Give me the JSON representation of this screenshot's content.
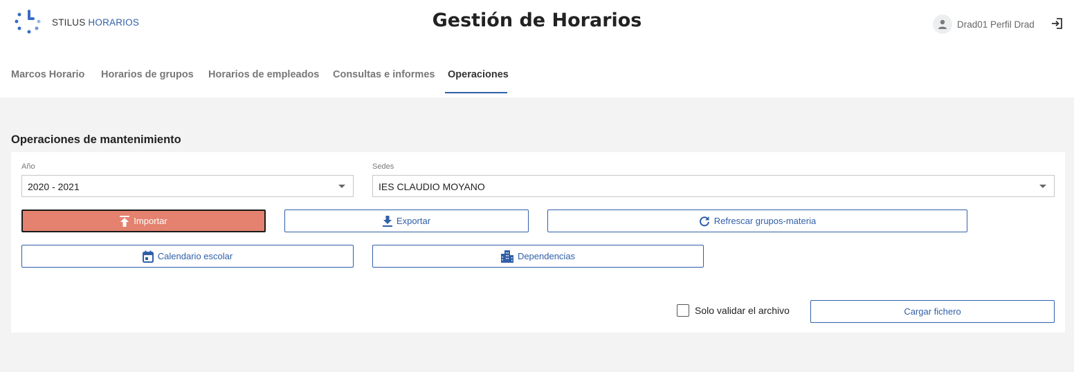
{
  "app": {
    "brand_part1": "STILUS",
    "brand_part2": "HORARIOS",
    "title": "Gestión de Horarios"
  },
  "user": {
    "name": "Drad01 Perfil Drad"
  },
  "tabs": [
    {
      "label": "Marcos Horario",
      "active": false
    },
    {
      "label": "Horarios de grupos",
      "active": false
    },
    {
      "label": "Horarios de empleados",
      "active": false
    },
    {
      "label": "Consultas e informes",
      "active": false
    },
    {
      "label": "Operaciones",
      "active": true
    }
  ],
  "section": {
    "title": "Operaciones de mantenimiento"
  },
  "form": {
    "year": {
      "label": "Año",
      "value": "2020 - 2021"
    },
    "sedes": {
      "label": "Sedes",
      "value": "IES CLAUDIO MOYANO"
    }
  },
  "actions": {
    "importar": "Importar",
    "exportar": "Exportar",
    "refrescar": "Refrescar grupos-materia",
    "calendario": "Calendario escolar",
    "dependencias": "Dependencias",
    "solo_validar": "Solo validar el archivo",
    "cargar": "Cargar fichero"
  },
  "colors": {
    "accent": "#2f5fa8",
    "importar_bg": "#e4826f",
    "background": "#f3f3f3"
  }
}
